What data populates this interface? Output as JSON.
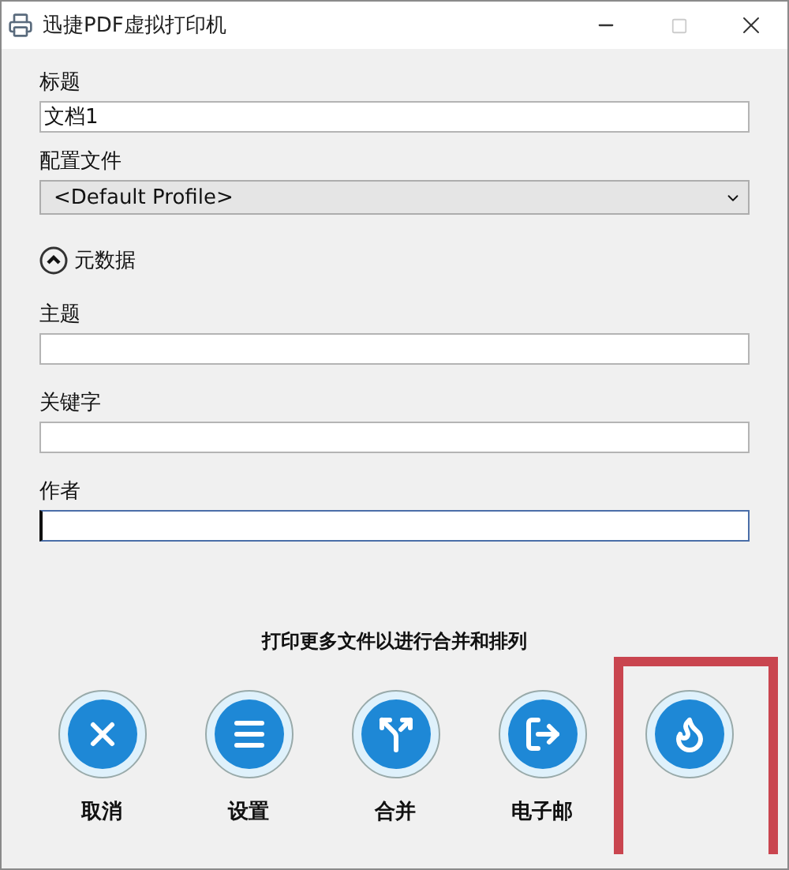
{
  "window": {
    "title": "迅捷PDF虚拟打印机"
  },
  "fields": [
    {
      "kind": "text",
      "label": "标题",
      "value": "文档1"
    },
    {
      "kind": "select",
      "label": "配置文件",
      "value": "<Default Profile>"
    }
  ],
  "metadata": {
    "label": "元数据",
    "expanded": true,
    "fields": [
      {
        "label": "主题",
        "focused": false
      },
      {
        "label": "关键字",
        "focused": false
      },
      {
        "label": "作者",
        "focused": true
      }
    ]
  },
  "hint": "打印更多文件以进行合并和排列",
  "actions": [
    {
      "kind": "cancel",
      "label": "取消",
      "highlighted": false
    },
    {
      "kind": "settings",
      "label": "设置",
      "highlighted": false
    },
    {
      "kind": "merge",
      "label": "合并",
      "highlighted": false
    },
    {
      "kind": "email",
      "label": "电子邮",
      "highlighted": false
    },
    {
      "kind": "save",
      "highlighted": true
    }
  ]
}
